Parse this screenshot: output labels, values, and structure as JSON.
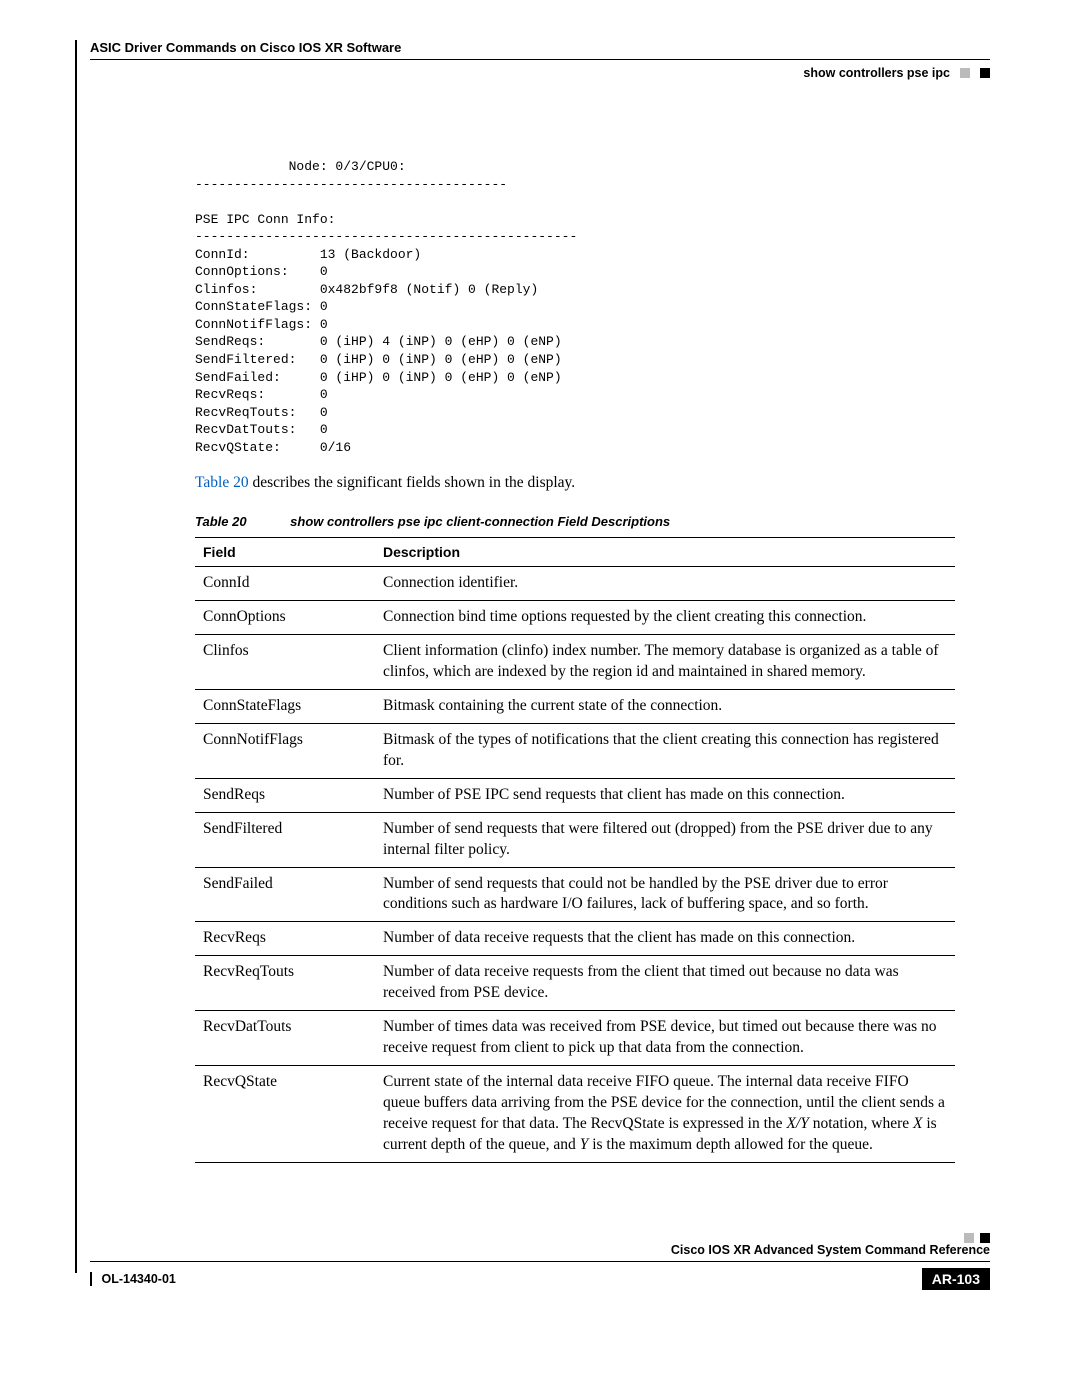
{
  "header": {
    "chapter": "ASIC Driver Commands on Cisco IOS XR Software",
    "breadcrumb": "show controllers pse ipc"
  },
  "cli": "            Node: 0/3/CPU0:\n----------------------------------------\n\nPSE IPC Conn Info:\n-------------------------------------------------\nConnId:         13 (Backdoor)\nConnOptions:    0\nClinfos:        0x482bf9f8 (Notif) 0 (Reply)\nConnStateFlags: 0\nConnNotifFlags: 0\nSendReqs:       0 (iHP) 4 (iNP) 0 (eHP) 0 (eNP)\nSendFiltered:   0 (iHP) 0 (iNP) 0 (eHP) 0 (eNP)\nSendFailed:     0 (iHP) 0 (iNP) 0 (eHP) 0 (eNP)\nRecvReqs:       0\nRecvReqTouts:   0\nRecvDatTouts:   0\nRecvQState:     0/16",
  "intro_link": "Table 20",
  "intro_rest": " describes the significant fields shown in the display.",
  "caption": {
    "label": "Table 20",
    "text": "show controllers pse ipc client-connection Field Descriptions"
  },
  "table": {
    "h_field": "Field",
    "h_desc": "Description",
    "rows": [
      {
        "f": "ConnId",
        "d": "Connection identifier."
      },
      {
        "f": "ConnOptions",
        "d": "Connection bind time options requested by the client creating this connection."
      },
      {
        "f": "Clinfos",
        "d": "Client information (clinfo) index number. The memory database is organized as a table of clinfos, which are indexed by the region id and maintained in shared memory."
      },
      {
        "f": "ConnStateFlags",
        "d": "Bitmask containing the current state of the connection."
      },
      {
        "f": "ConnNotifFlags",
        "d": "Bitmask of the types of notifications that the client creating this connection has registered for."
      },
      {
        "f": "SendReqs",
        "d": "Number of PSE IPC send requests that client has made on this connection."
      },
      {
        "f": "SendFiltered",
        "d": "Number of send requests that were filtered out (dropped) from the PSE driver due to any internal filter policy."
      },
      {
        "f": "SendFailed",
        "d": "Number of send requests that could not be handled by the PSE driver due to error conditions such as hardware I/O failures, lack of buffering space, and so forth."
      },
      {
        "f": "RecvReqs",
        "d": "Number of data receive requests that the client has made on this connection."
      },
      {
        "f": "RecvReqTouts",
        "d": "Number of data receive requests from the client that timed out because no data was received from PSE device."
      },
      {
        "f": "RecvDatTouts",
        "d": "Number of times data was received from PSE device, but timed out because there was no receive request from client to pick up that data from the connection."
      }
    ],
    "last": {
      "f": "RecvQState",
      "d_pre": "Current state of the internal data receive FIFO queue. The internal data receive FIFO queue buffers data arriving from the PSE device for the connection, until the client sends a receive request for that data. The RecvQState is expressed in the ",
      "xy": "X/Y",
      "d_mid": " notation, where ",
      "x": "X",
      "d_mid2": " is current depth of the queue, and ",
      "y": "Y",
      "d_post": " is the maximum depth allowed for the queue."
    }
  },
  "footer": {
    "book": "Cisco IOS XR Advanced System Command Reference",
    "docnum": "OL-14340-01",
    "page": "AR-103"
  }
}
